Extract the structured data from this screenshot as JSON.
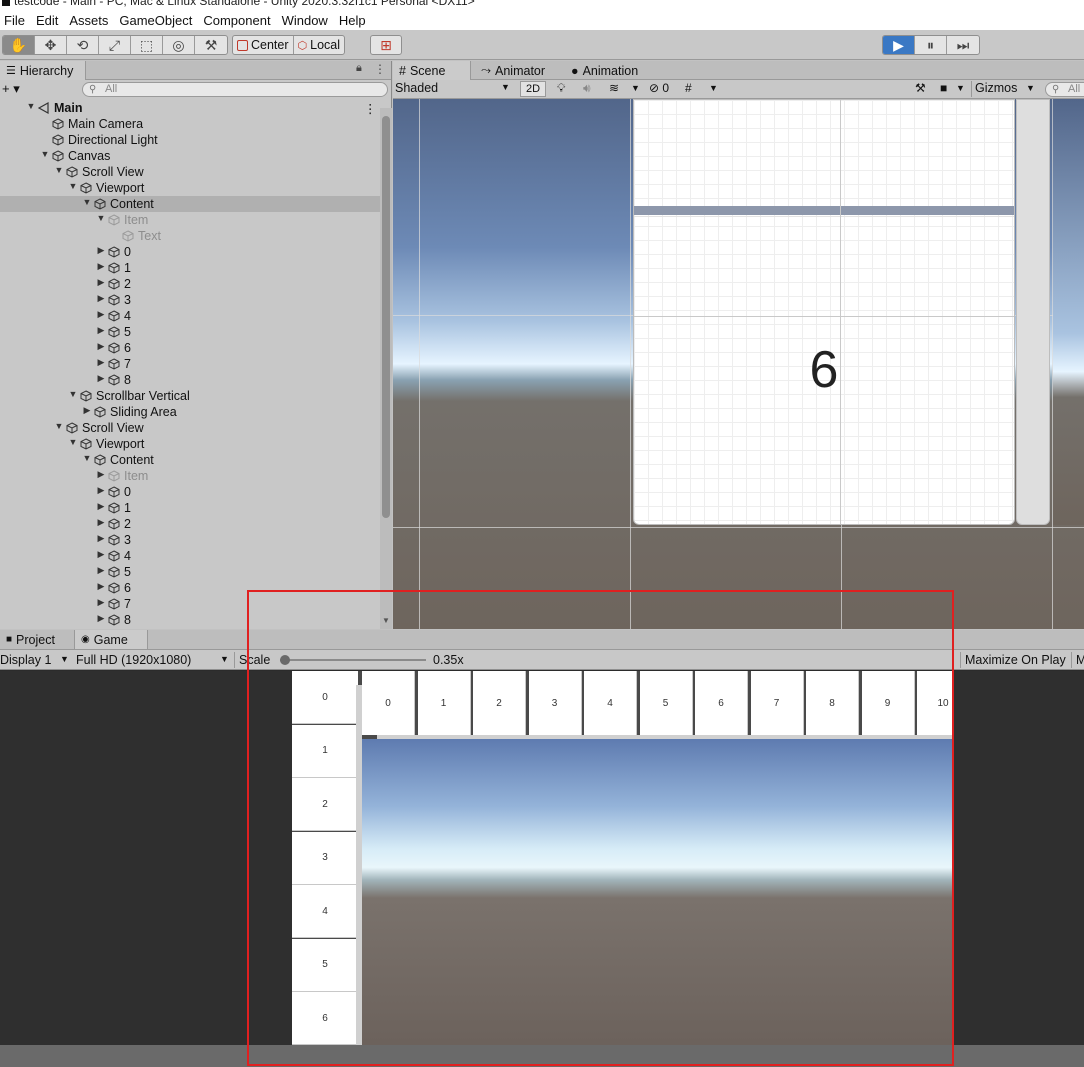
{
  "window": {
    "title": "testcode - Main - PC, Mac & Linux Standalone - Unity 2020.3.32f1c1 Personal <DX11>"
  },
  "menu": [
    "File",
    "Edit",
    "Assets",
    "GameObject",
    "Component",
    "Window",
    "Help"
  ],
  "toolbar": {
    "tools": [
      {
        "name": "hand-tool",
        "glyph": "✋"
      },
      {
        "name": "move-tool",
        "glyph": "✥"
      },
      {
        "name": "rotate-tool",
        "glyph": "⟲"
      },
      {
        "name": "scale-tool",
        "glyph": "⤢"
      },
      {
        "name": "rect-tool",
        "glyph": "⬚"
      },
      {
        "name": "transform-tool",
        "glyph": "◎"
      },
      {
        "name": "custom-tool",
        "glyph": "⚒"
      }
    ],
    "pivot": "Center",
    "space": "Local"
  },
  "hierarchy": {
    "tab_label": "Hierarchy",
    "add_label": "+ ▾",
    "search_placeholder": "All",
    "rows": [
      {
        "label": "Main",
        "depth": 0,
        "arrow": "▼",
        "bold": true,
        "scene": true
      },
      {
        "label": "Main Camera",
        "depth": 1,
        "arrow": ""
      },
      {
        "label": "Directional Light",
        "depth": 1,
        "arrow": ""
      },
      {
        "label": "Canvas",
        "depth": 1,
        "arrow": "▼"
      },
      {
        "label": "Scroll View",
        "depth": 2,
        "arrow": "▼"
      },
      {
        "label": "Viewport",
        "depth": 3,
        "arrow": "▼"
      },
      {
        "label": "Content",
        "depth": 4,
        "arrow": "▼",
        "selected": true
      },
      {
        "label": "Item",
        "depth": 5,
        "arrow": "▼",
        "dim": true
      },
      {
        "label": "Text",
        "depth": 6,
        "arrow": "",
        "dim": true
      },
      {
        "label": "0",
        "depth": 5,
        "arrow": "▶"
      },
      {
        "label": "1",
        "depth": 5,
        "arrow": "▶"
      },
      {
        "label": "2",
        "depth": 5,
        "arrow": "▶"
      },
      {
        "label": "3",
        "depth": 5,
        "arrow": "▶"
      },
      {
        "label": "4",
        "depth": 5,
        "arrow": "▶"
      },
      {
        "label": "5",
        "depth": 5,
        "arrow": "▶"
      },
      {
        "label": "6",
        "depth": 5,
        "arrow": "▶"
      },
      {
        "label": "7",
        "depth": 5,
        "arrow": "▶"
      },
      {
        "label": "8",
        "depth": 5,
        "arrow": "▶"
      },
      {
        "label": "Scrollbar Vertical",
        "depth": 3,
        "arrow": "▼"
      },
      {
        "label": "Sliding Area",
        "depth": 4,
        "arrow": "▶"
      },
      {
        "label": "Scroll View",
        "depth": 2,
        "arrow": "▼"
      },
      {
        "label": "Viewport",
        "depth": 3,
        "arrow": "▼"
      },
      {
        "label": "Content",
        "depth": 4,
        "arrow": "▼"
      },
      {
        "label": "Item",
        "depth": 5,
        "arrow": "▶",
        "dim": true
      },
      {
        "label": "0",
        "depth": 5,
        "arrow": "▶"
      },
      {
        "label": "1",
        "depth": 5,
        "arrow": "▶"
      },
      {
        "label": "2",
        "depth": 5,
        "arrow": "▶"
      },
      {
        "label": "3",
        "depth": 5,
        "arrow": "▶"
      },
      {
        "label": "4",
        "depth": 5,
        "arrow": "▶"
      },
      {
        "label": "5",
        "depth": 5,
        "arrow": "▶"
      },
      {
        "label": "6",
        "depth": 5,
        "arrow": "▶"
      },
      {
        "label": "7",
        "depth": 5,
        "arrow": "▶"
      },
      {
        "label": "8",
        "depth": 5,
        "arrow": "▶"
      }
    ]
  },
  "scene": {
    "tabs": [
      {
        "label": "Scene",
        "icon": "#"
      },
      {
        "label": "Animator",
        "icon": "⤳"
      },
      {
        "label": "Animation",
        "icon": "●"
      }
    ],
    "shading": "Shaded",
    "mode_2d": "2D",
    "hidden_count": "0",
    "gizmos": "Gizmos",
    "search_placeholder": "All",
    "item_number": "6"
  },
  "game": {
    "tabs": [
      {
        "label": "Project",
        "icon": "■"
      },
      {
        "label": "Game",
        "icon": "◉"
      }
    ],
    "display": "Display 1",
    "resolution": "Full HD (1920x1080)",
    "scale_label": "Scale",
    "scale_value": "0.35x",
    "scale_fraction": 0.0,
    "maximize": "Maximize On Play",
    "trailing": "M",
    "rows": [
      "0",
      "1",
      "2",
      "3",
      "4",
      "5",
      "6"
    ],
    "columns": [
      "0",
      "1",
      "2",
      "3",
      "4",
      "5",
      "6",
      "7",
      "8",
      "9",
      "10"
    ]
  },
  "colors": {
    "accent_play": "#3a78c4",
    "highlight_box": "#e02020"
  }
}
